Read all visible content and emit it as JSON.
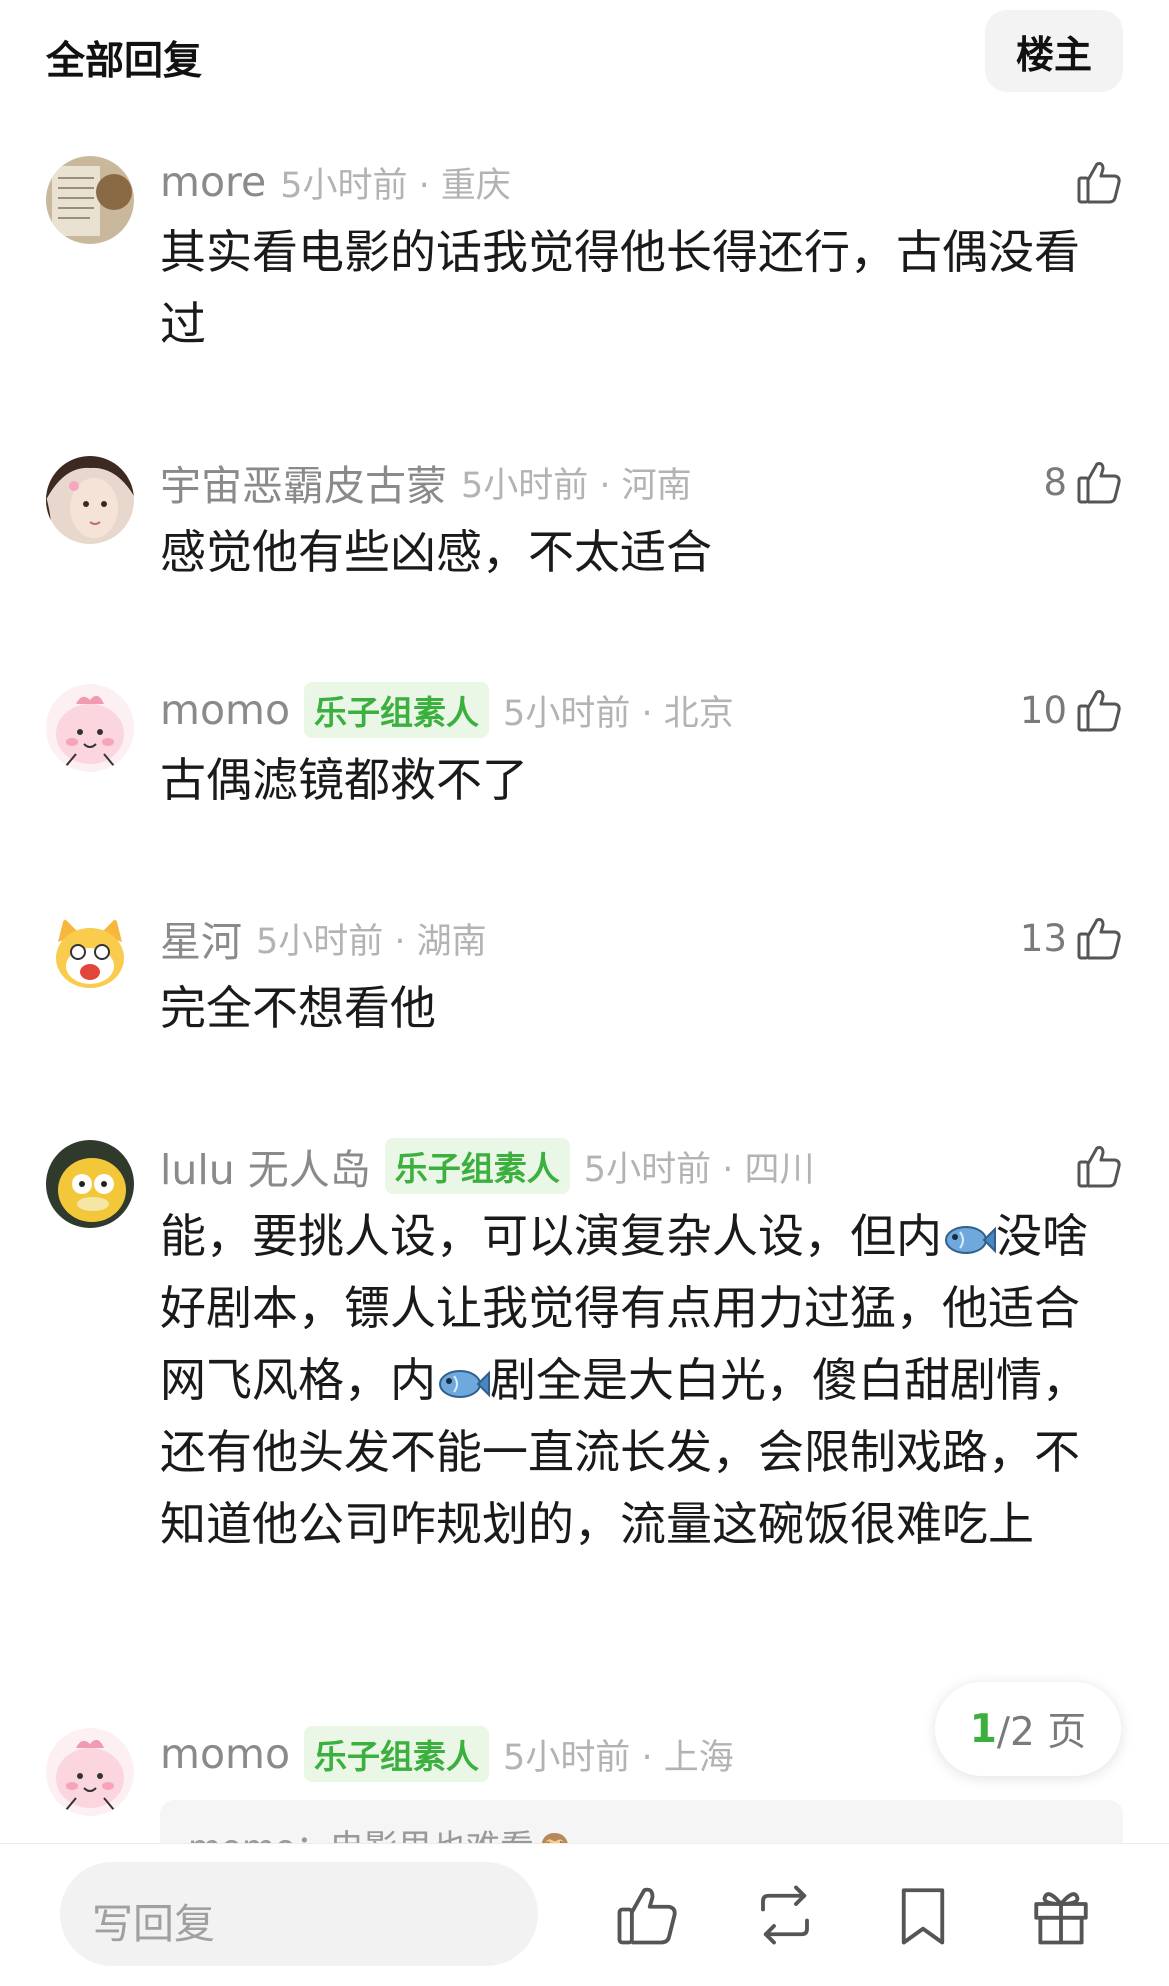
{
  "header": {
    "title": "全部回复",
    "op_label": "楼主"
  },
  "comments": [
    {
      "username": "more",
      "time_location": "5小时前 · 重庆",
      "text": "其实看电影的话我觉得他长得还行，古偶没看过",
      "likes": ""
    },
    {
      "username": "宇宙恶霸皮古蒙",
      "time_location": "5小时前 · 河南",
      "text": "感觉他有些凶感，不太适合",
      "likes": "8"
    },
    {
      "username": "momo",
      "badge": "乐子组素人",
      "time_location": "5小时前 · 北京",
      "text": "古偶滤镜都救不了",
      "likes": "10"
    },
    {
      "username": "星河",
      "time_location": "5小时前 · 湖南",
      "text": "完全不想看他",
      "likes": "13"
    },
    {
      "username": "lulu 无人岛",
      "badge": "乐子组素人",
      "time_location": "5小时前 · 四川",
      "text_parts": [
        "能，要挑人设，可以演复杂人设，但内",
        "没啥好剧本，镖人让我觉得有点用力过猛，他适合网飞风格，内",
        "剧全是大白光，傻白甜剧情，还有他头发不能一直流长发，会限制戏路，不知道他公司咋规划的，流量这碗饭很难吃上"
      ],
      "likes": ""
    },
    {
      "username": "momo",
      "badge": "乐子组素人",
      "time_location": "5小时前 · 上海",
      "quote": "momo：电影里也难看🙈",
      "likes": ""
    }
  ],
  "pagination": {
    "current": "1",
    "total": "/2 页"
  },
  "reply_bar": {
    "placeholder": "写回复"
  },
  "colors": {
    "accent_green": "#3bb03e",
    "badge_bg": "#eaf6e6",
    "meta_gray": "#b3b3b3"
  },
  "icons": [
    "thumb-up-icon",
    "repost-icon",
    "bookmark-icon",
    "gift-icon",
    "fish-emoji-icon"
  ]
}
